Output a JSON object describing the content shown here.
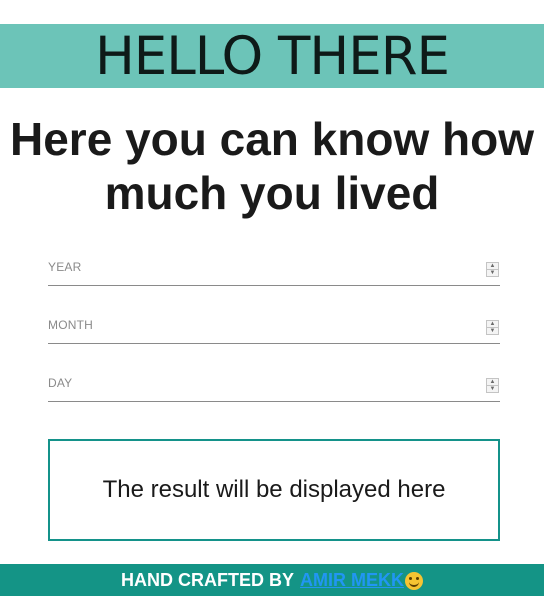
{
  "header": {
    "title": "HELLO THERE"
  },
  "headline": {
    "line1": "Here you can know how",
    "line2": "much you lived"
  },
  "form": {
    "fields": [
      {
        "placeholder": "YEAR",
        "value": ""
      },
      {
        "placeholder": "MONTH",
        "value": ""
      },
      {
        "placeholder": "DAY",
        "value": ""
      }
    ]
  },
  "result": {
    "text": "The result will be displayed here"
  },
  "footer": {
    "prefix": "HAND CRAFTED BY",
    "author_link": "AMIR MEKK",
    "emoji_icon": "smiley-icon"
  },
  "colors": {
    "header_bg": "#6cc4b8",
    "accent": "#149486",
    "result_border": "#14928a",
    "link": "#2196f3"
  }
}
